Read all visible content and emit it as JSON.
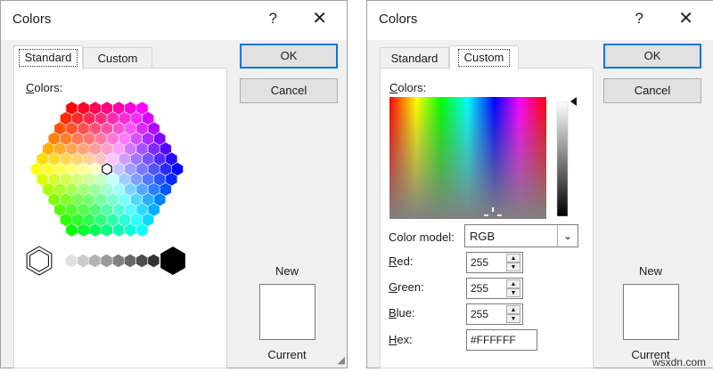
{
  "dialogs": [
    {
      "title": "Colors",
      "help_label": "?",
      "close_label": "✕",
      "tabs": [
        {
          "label": "Standard",
          "active": true
        },
        {
          "label": "Custom",
          "active": false
        }
      ],
      "ok_label": "OK",
      "cancel_label": "Cancel",
      "colors_label": "Colors:",
      "new_label": "New",
      "current_label": "Current"
    },
    {
      "title": "Colors",
      "help_label": "?",
      "close_label": "✕",
      "tabs": [
        {
          "label": "Standard",
          "active": false
        },
        {
          "label": "Custom",
          "active": true
        }
      ],
      "ok_label": "OK",
      "cancel_label": "Cancel",
      "colors_label": "Colors:",
      "color_model_label": "Color model:",
      "color_model_value": "RGB",
      "red_label": "Red:",
      "red_value": "255",
      "green_label": "Green:",
      "green_value": "255",
      "blue_label": "Blue:",
      "blue_value": "255",
      "hex_label": "Hex:",
      "hex_value": "#FFFFFF",
      "new_label": "New",
      "current_label": "Current"
    }
  ],
  "selected_color": "#FFFFFF",
  "accent_color": "#0078D7",
  "watermark": "wsxdn.com"
}
